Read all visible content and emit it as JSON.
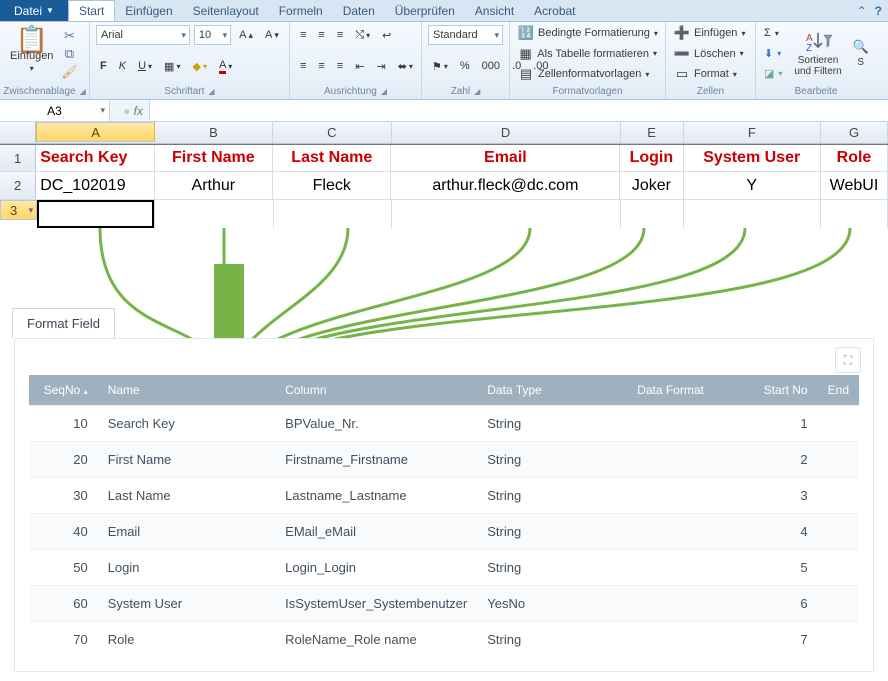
{
  "excel": {
    "file_menu": "Datei",
    "tabs": [
      "Start",
      "Einfügen",
      "Seitenlayout",
      "Formeln",
      "Daten",
      "Überprüfen",
      "Ansicht",
      "Acrobat"
    ],
    "active_tab": "Start",
    "ribbon": {
      "clipboard": {
        "paste": "Einfügen",
        "label": "Zwischenablage"
      },
      "font": {
        "name": "Arial",
        "size": "10",
        "label": "Schriftart"
      },
      "align": {
        "label": "Ausrichtung"
      },
      "number": {
        "format": "Standard",
        "label": "Zahl"
      },
      "styles": {
        "cond": "Bedingte Formatierung",
        "astable": "Als Tabelle formatieren",
        "cellfmt": "Zellenformatvorlagen",
        "label": "Formatvorlagen"
      },
      "cells": {
        "ins": "Einfügen",
        "del": "Löschen",
        "fmt": "Format",
        "label": "Zellen"
      },
      "editing": {
        "sort": "Sortieren\nund Filtern",
        "find": "S",
        "label": "Bearbeite"
      }
    },
    "namebox": "A3",
    "fx": "fx",
    "columns": [
      "A",
      "B",
      "C",
      "D",
      "E",
      "F",
      "G"
    ],
    "headers": [
      "Search Key",
      "First Name",
      "Last Name",
      "Email",
      "Login",
      "System User",
      "Role"
    ],
    "data": [
      "DC_102019",
      "Arthur",
      "Fleck",
      "arthur.fleck@dc.com",
      "Joker",
      "Y",
      "WebUI"
    ],
    "active_cell": "A3"
  },
  "panel": {
    "tab": "Format Field",
    "columns": [
      "SeqNo",
      "Name",
      "Column",
      "Data Type",
      "Data Format",
      "Start No",
      "End"
    ],
    "rows": [
      {
        "seq": "10",
        "name": "Search Key",
        "col": "BPValue_Nr.",
        "type": "String",
        "fmt": "",
        "start": "1",
        "end": ""
      },
      {
        "seq": "20",
        "name": "First Name",
        "col": "Firstname_Firstname",
        "type": "String",
        "fmt": "",
        "start": "2",
        "end": ""
      },
      {
        "seq": "30",
        "name": "Last Name",
        "col": "Lastname_Lastname",
        "type": "String",
        "fmt": "",
        "start": "3",
        "end": ""
      },
      {
        "seq": "40",
        "name": "Email",
        "col": "EMail_eMail",
        "type": "String",
        "fmt": "",
        "start": "4",
        "end": ""
      },
      {
        "seq": "50",
        "name": "Login",
        "col": "Login_Login",
        "type": "String",
        "fmt": "",
        "start": "5",
        "end": ""
      },
      {
        "seq": "60",
        "name": "System User",
        "col": "IsSystemUser_Systembenutzer",
        "type": "YesNo",
        "fmt": "",
        "start": "6",
        "end": ""
      },
      {
        "seq": "70",
        "name": "Role",
        "col": "RoleName_Role name",
        "type": "String",
        "fmt": "",
        "start": "7",
        "end": ""
      }
    ]
  }
}
